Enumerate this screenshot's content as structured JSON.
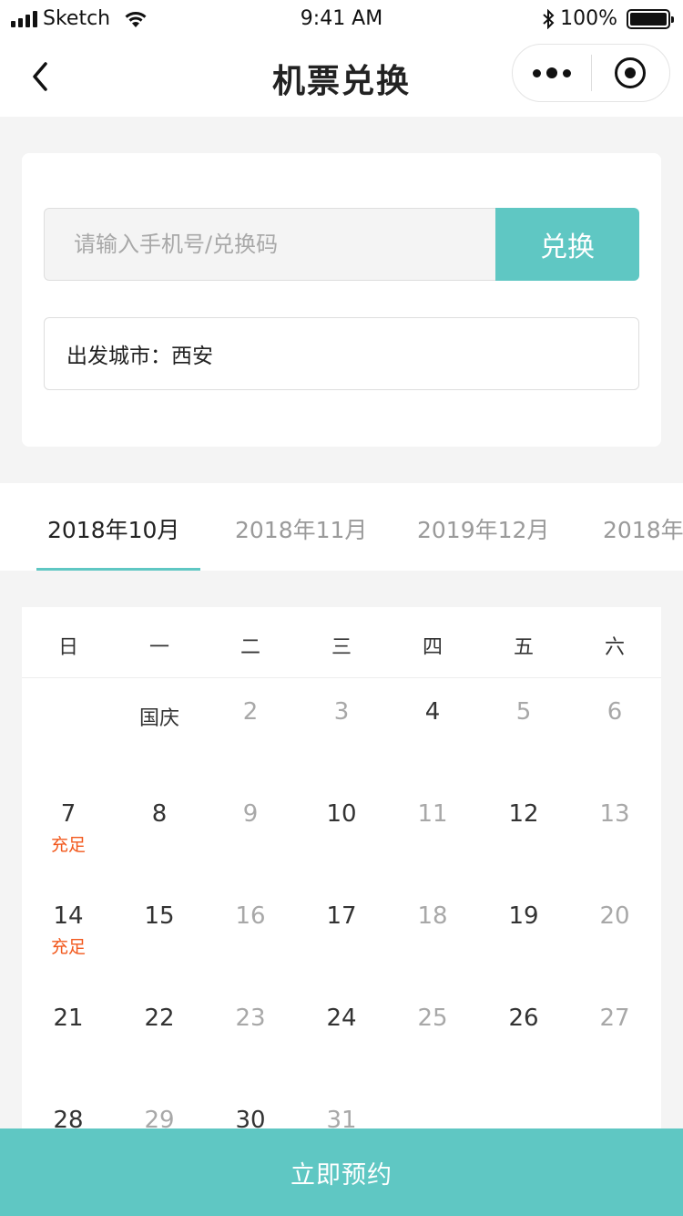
{
  "status_bar": {
    "carrier": "Sketch",
    "time": "9:41 AM",
    "battery": "100%",
    "icons": [
      "signal-icon",
      "wifi-icon",
      "bluetooth-icon",
      "battery-icon"
    ]
  },
  "nav": {
    "title": "机票兑换",
    "icons": [
      "back-arrow-icon",
      "more-dots-icon",
      "close-target-icon"
    ]
  },
  "redeem": {
    "placeholder": "请输入手机号/兑换码",
    "value": "",
    "button_label": "兑换"
  },
  "city": {
    "label": "出发城市：西安"
  },
  "month_tabs": [
    {
      "label": "2018年10月",
      "active": true
    },
    {
      "label": "2018年11月",
      "active": false
    },
    {
      "label": "2019年12月",
      "active": false
    },
    {
      "label": "2018年",
      "active": false
    }
  ],
  "calendar": {
    "weekdays": [
      "日",
      "一",
      "二",
      "三",
      "四",
      "五",
      "六"
    ],
    "weeks": [
      [
        null,
        {
          "text": "国庆",
          "style": "label"
        },
        {
          "text": "2",
          "style": "light"
        },
        {
          "text": "3",
          "style": "light"
        },
        {
          "text": "4",
          "style": "dark"
        },
        {
          "text": "5",
          "style": "light"
        },
        {
          "text": "6",
          "style": "light"
        }
      ],
      [
        {
          "text": "7",
          "style": "dark",
          "tag": "充足"
        },
        {
          "text": "8",
          "style": "dark"
        },
        {
          "text": "9",
          "style": "light"
        },
        {
          "text": "10",
          "style": "dark"
        },
        {
          "text": "11",
          "style": "light"
        },
        {
          "text": "12",
          "style": "dark"
        },
        {
          "text": "13",
          "style": "light"
        }
      ],
      [
        {
          "text": "14",
          "style": "dark",
          "tag": "充足"
        },
        {
          "text": "15",
          "style": "dark"
        },
        {
          "text": "16",
          "style": "light"
        },
        {
          "text": "17",
          "style": "dark"
        },
        {
          "text": "18",
          "style": "light"
        },
        {
          "text": "19",
          "style": "dark"
        },
        {
          "text": "20",
          "style": "light"
        }
      ],
      [
        {
          "text": "21",
          "style": "dark"
        },
        {
          "text": "22",
          "style": "dark"
        },
        {
          "text": "23",
          "style": "light"
        },
        {
          "text": "24",
          "style": "dark"
        },
        {
          "text": "25",
          "style": "light"
        },
        {
          "text": "26",
          "style": "dark"
        },
        {
          "text": "27",
          "style": "light"
        }
      ],
      [
        {
          "text": "28",
          "style": "dark"
        },
        {
          "text": "29",
          "style": "light"
        },
        {
          "text": "30",
          "style": "dark"
        },
        {
          "text": "31",
          "style": "light"
        },
        null,
        null,
        null
      ]
    ]
  },
  "footer": {
    "book_label": "立即预约"
  },
  "colors": {
    "accent": "#5fc7c3",
    "tag": "#f2581c",
    "muted": "#a8a8a8"
  }
}
